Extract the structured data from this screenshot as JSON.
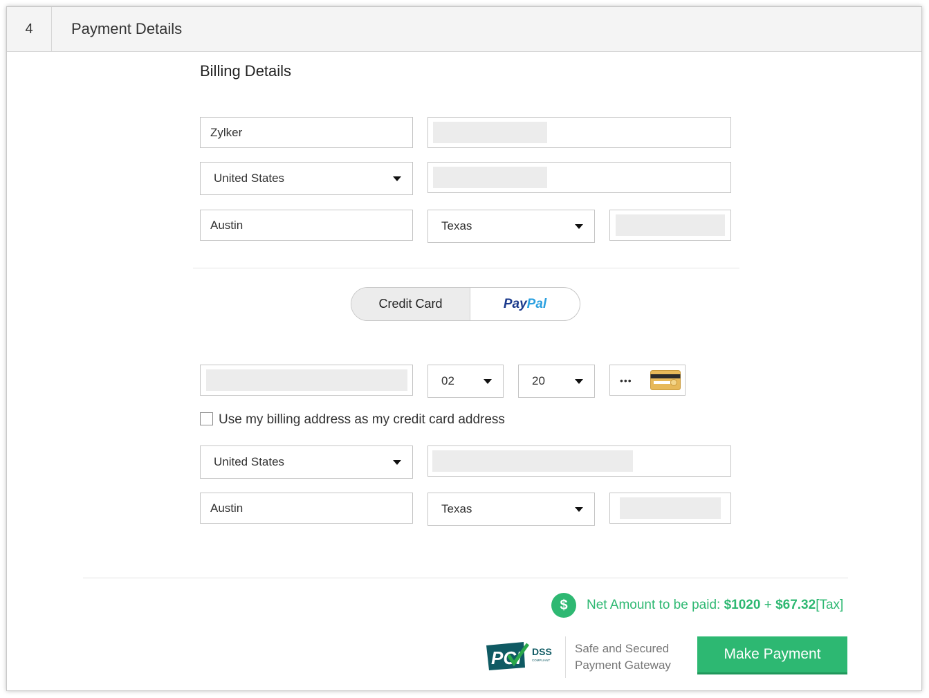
{
  "header": {
    "step": "4",
    "title": "Payment Details"
  },
  "billing": {
    "title": "Billing Details",
    "name_value": "Zylker",
    "country_value": "United States",
    "city_value": "Austin",
    "state_value": "Texas"
  },
  "method_toggle": {
    "credit_card_label": "Credit Card",
    "paypal_part1": "Pay",
    "paypal_part2": "Pal"
  },
  "card": {
    "exp_month_value": "02",
    "exp_year_value": "20",
    "cvv_value": "•••"
  },
  "checkbox_label": "Use my billing address as my credit card address",
  "card_address": {
    "country_value": "United States",
    "city_value": "Austin",
    "state_value": "Texas"
  },
  "footer": {
    "currency_symbol": "$",
    "net_label": "Net Amount to be paid: ",
    "net_amount": "$1020",
    "net_plus": " + ",
    "net_tax_amount": "$67.32",
    "net_tax_label": "[Tax]",
    "secure_line1": "Safe and Secured",
    "secure_line2": "Payment Gateway",
    "pci_text": "PCI",
    "dss_text": "DSS",
    "compliant_text": "COMPLIANT",
    "pay_button": "Make Payment"
  },
  "colors": {
    "accent_green": "#2eb872",
    "paypal_dark": "#1b3a8c",
    "paypal_light": "#2aa0e0"
  }
}
